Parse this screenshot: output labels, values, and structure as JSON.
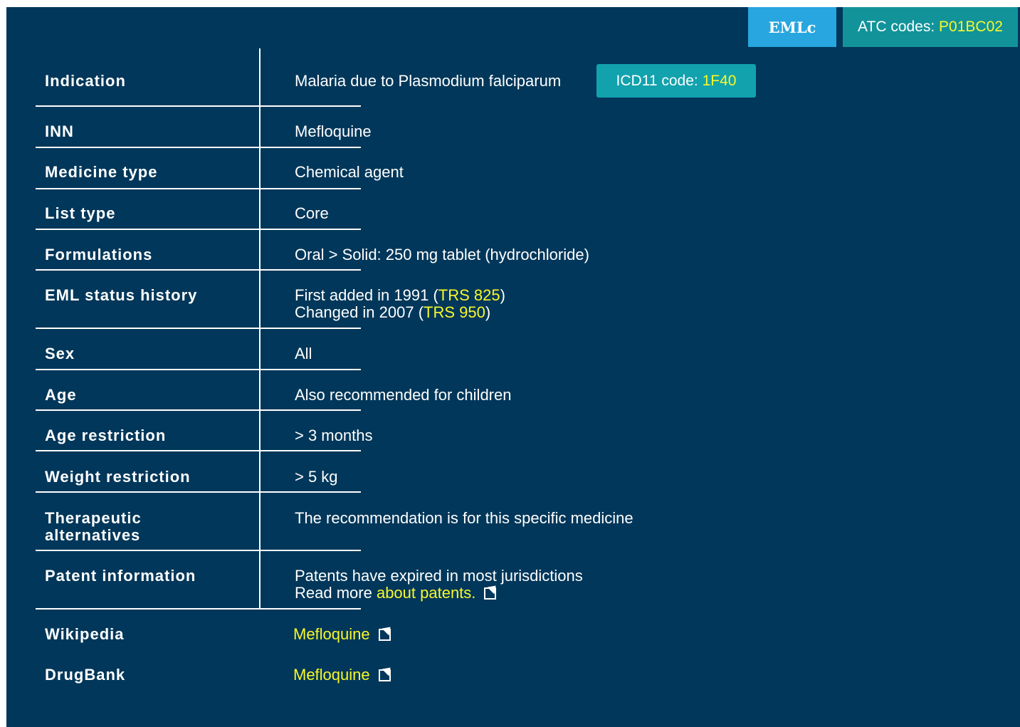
{
  "tags": {
    "eml": "EMLc",
    "atc_prefix": "ATC codes: ",
    "atc_code": "P01BC02"
  },
  "icd": {
    "prefix": "ICD11 code: ",
    "code": "1F40"
  },
  "rows": {
    "indication": {
      "label": "Indication",
      "value": "Malaria due to Plasmodium falciparum"
    },
    "inn": {
      "label": "INN",
      "value": "Mefloquine"
    },
    "medicine_type": {
      "label": "Medicine type",
      "value": "Chemical agent"
    },
    "list_type": {
      "label": "List type",
      "value": "Core"
    },
    "formulations": {
      "label": "Formulations",
      "value": "Oral > Solid: 250 mg tablet (hydrochloride)"
    },
    "eml_status": {
      "label": "EML status history",
      "line1_prefix": "First added in 1991 (",
      "line1_link": "TRS 825",
      "line1_suffix": ")",
      "line2_prefix": "Changed in 2007 (",
      "line2_link": "TRS 950",
      "line2_suffix": ")"
    },
    "sex": {
      "label": "Sex",
      "value": "All"
    },
    "age": {
      "label": "Age",
      "value": "Also recommended for children"
    },
    "age_restriction": {
      "label": "Age restriction",
      "value": "> 3 months"
    },
    "weight_restriction": {
      "label": "Weight restriction",
      "value": "> 5 kg"
    },
    "therapeutic": {
      "label_line1": "Therapeutic",
      "label_line2": "alternatives",
      "value": "The recommendation is for this specific medicine"
    },
    "patent": {
      "label": "Patent information",
      "line1": "Patents have expired in most jurisdictions",
      "line2_prefix": "Read more ",
      "line2_link": "about patents."
    },
    "wikipedia": {
      "label": "Wikipedia",
      "link": "Mefloquine"
    },
    "drugbank": {
      "label": "DrugBank",
      "link": "Mefloquine"
    }
  },
  "icons": {
    "external_link": "external-link-icon"
  },
  "colors": {
    "panel_bg": "#01375a",
    "eml_tag": "#27a6df",
    "atc_tag": "#12939a",
    "icd_tag": "#12a2ad",
    "link": "#f8f82a"
  }
}
